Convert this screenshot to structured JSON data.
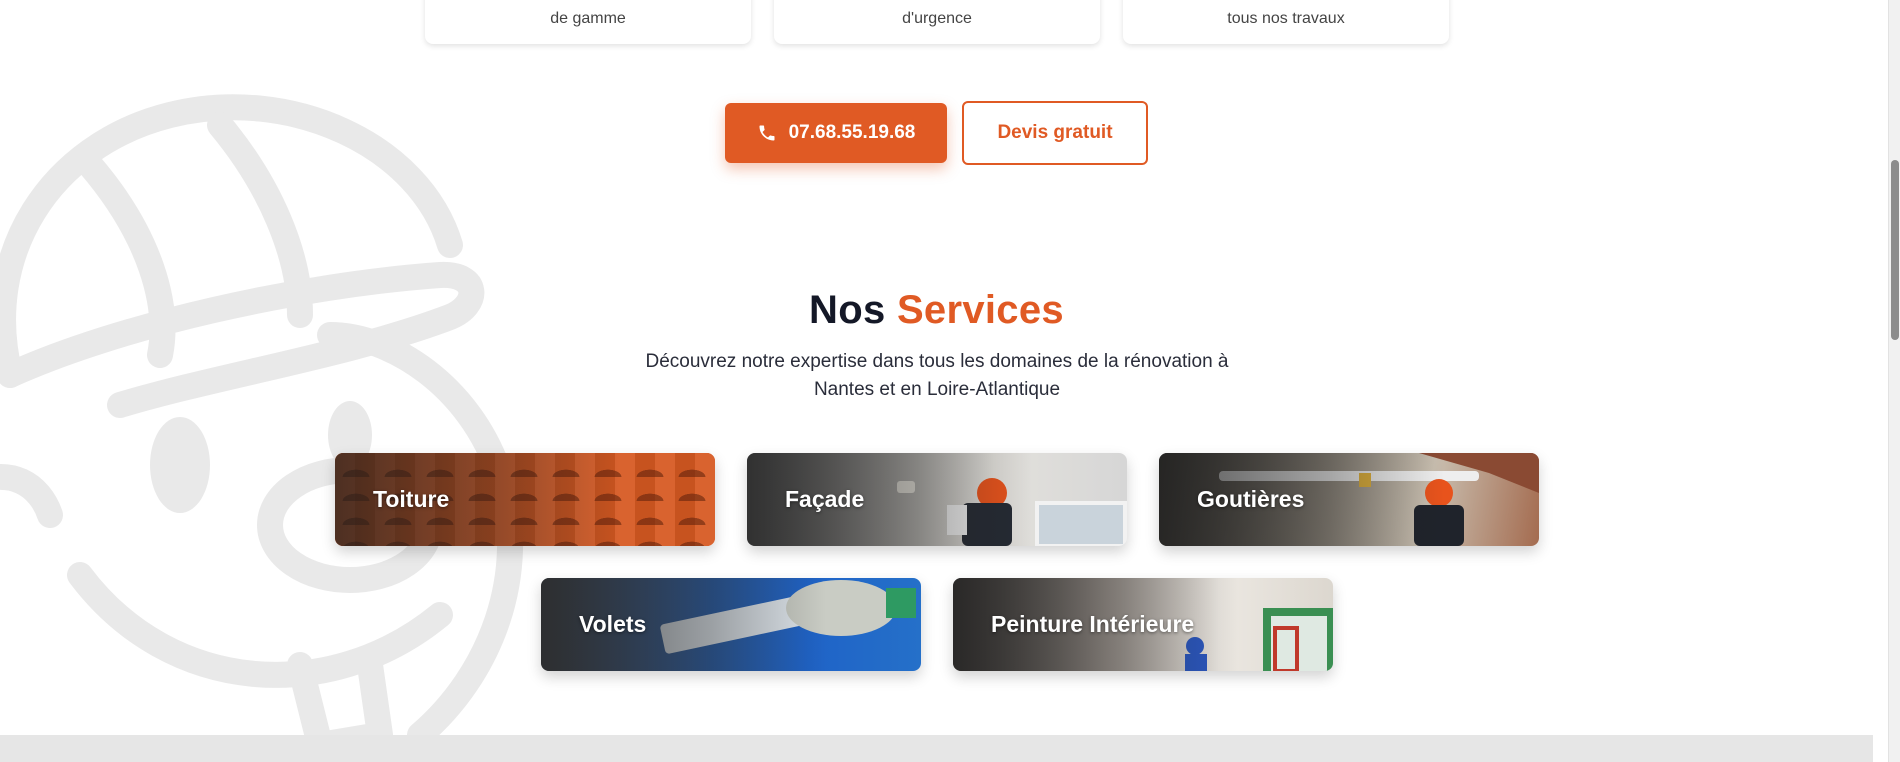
{
  "features": [
    {
      "text": "de gamme"
    },
    {
      "text": "d'urgence"
    },
    {
      "text": "tous nos travaux"
    }
  ],
  "cta": {
    "phone_label": "07.68.55.19.68",
    "phone_icon": "phone-icon",
    "devis_label": "Devis gratuit"
  },
  "services_section": {
    "title_part1": "Nos",
    "title_part2": "Services",
    "subtitle_line1": "Découvrez notre expertise dans tous les domaines de la rénovation à",
    "subtitle_line2": "Nantes et en Loire-Atlantique"
  },
  "services": [
    {
      "label": "Toiture"
    },
    {
      "label": "Façade"
    },
    {
      "label": "Goutières"
    },
    {
      "label": "Volets"
    },
    {
      "label": "Peinture Intérieure"
    }
  ],
  "colors": {
    "accent": "#e05a24",
    "heading": "#141827",
    "footer": "#e6e6e6"
  }
}
